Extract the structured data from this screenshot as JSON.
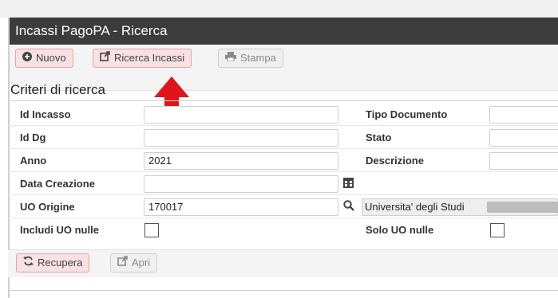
{
  "window": {
    "title": "Incassi PagoPA - Ricerca"
  },
  "toolbar": {
    "nuovo_label": "Nuovo",
    "ricerca_label": "Ricerca Incassi",
    "stampa_label": "Stampa"
  },
  "section": {
    "title": "Criteri di ricerca"
  },
  "fields": {
    "id_incasso": {
      "label": "Id Incasso",
      "value": ""
    },
    "tipo_documento": {
      "label": "Tipo Documento",
      "value": ""
    },
    "id_dg": {
      "label": "Id Dg",
      "value": ""
    },
    "stato": {
      "label": "Stato",
      "value": ""
    },
    "anno": {
      "label": "Anno",
      "value": "2021"
    },
    "descrizione": {
      "label": "Descrizione",
      "value": ""
    },
    "data_creazione": {
      "label": "Data Creazione",
      "value": ""
    },
    "uo_origine": {
      "label": "UO Origine",
      "value": "170017",
      "lookup": "Universita' degli Studi"
    },
    "includi_uo_nulle": {
      "label": "Includi UO nulle"
    },
    "solo_uo_nulle": {
      "label": "Solo UO nulle"
    }
  },
  "bottom": {
    "recupera_label": "Recupera",
    "apri_label": "Apri"
  },
  "colors": {
    "titlebar": "#3c3c3c",
    "pink_button_bg": "#f8e1e2",
    "pink_button_border": "#e6a4a8",
    "arrow": "#e0151b"
  },
  "icons": {
    "nuovo": "plus-circle-icon",
    "ricerca": "external-link-icon",
    "stampa": "printer-icon",
    "calendar": "calendar-icon",
    "search": "search-icon",
    "recupera": "refresh-icon",
    "apri": "external-link-icon"
  }
}
